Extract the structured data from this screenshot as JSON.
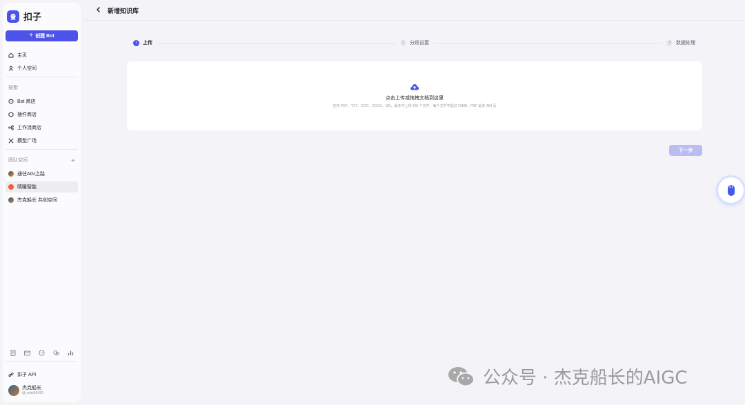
{
  "app": {
    "name": "扣子"
  },
  "sidebar": {
    "create_button": "创建 Bot",
    "nav": [
      {
        "label": "主页"
      },
      {
        "label": "个人空间"
      }
    ],
    "explore_label": "探索",
    "explore": [
      {
        "label": "Bot 商店"
      },
      {
        "label": "插件商店"
      },
      {
        "label": "工作流商店"
      },
      {
        "label": "模型广场"
      }
    ],
    "team_label": "团队空间",
    "teams": [
      {
        "label": "通往AGI之路"
      },
      {
        "label": "晴暖智能"
      },
      {
        "label": "杰克船长 共创空间"
      }
    ],
    "api_label": "扣子 API",
    "user": {
      "name": "杰克船长",
      "id": "@ yvhk59420"
    }
  },
  "header": {
    "title": "新增知识库"
  },
  "steps": [
    {
      "num": "1",
      "label": "上传"
    },
    {
      "num": "2",
      "label": "分段设置"
    },
    {
      "num": "3",
      "label": "数据处理"
    }
  ],
  "upload": {
    "main_text": "点击上传或拖拽文档到这里",
    "hint": "支持 PDF、TXT、DOC、DOCX、MD，最多可上传 300 个文件，每个文件不超过 20MB，PDF 最多 250 页"
  },
  "next_button": "下一步",
  "watermark": "公众号 · 杰克船长的AIGC",
  "colors": {
    "accent": "#4d53e8",
    "accent_disabled": "#b9bdf2"
  }
}
